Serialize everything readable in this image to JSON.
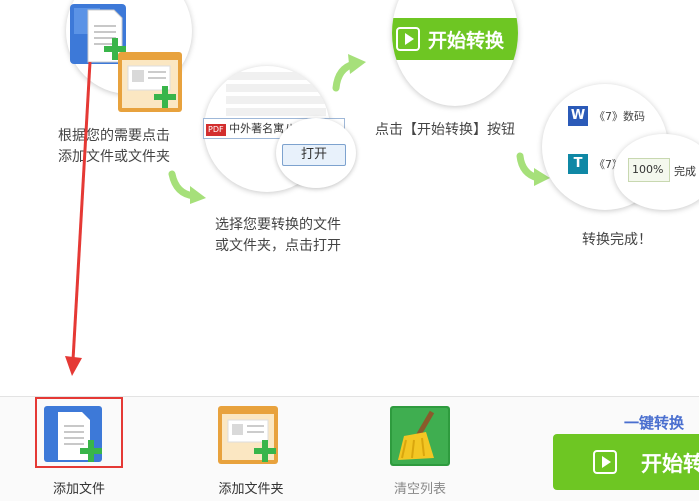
{
  "steps": {
    "step1_caption_line1": "根据您的需要点击",
    "step1_caption_line2": "添加文件或文件夹",
    "step2_caption_line1": "选择您要转换的文件",
    "step2_caption_line2": "或文件夹，点击打开",
    "step2_file_name": "中外著名寓八*.pdf,",
    "step2_open_button": "打开",
    "step3_start_label": "开始转换",
    "step3_caption": "点击【开始转换】按钮",
    "step4_row1_text": "《7》数码",
    "step4_row2_text": "《7》",
    "step4_progress": "100%",
    "step4_done_label": "完成",
    "step4_caption": "转换完成！"
  },
  "toolbar": {
    "add_file_label": "添加文件",
    "add_folder_label": "添加文件夹",
    "clear_list_label": "清空列表",
    "one_click_label": "一键转换",
    "start_button_label": "开始转"
  },
  "colors": {
    "accent_green": "#6ec623",
    "highlight_red": "#e53935",
    "link_blue": "#4a6fcf"
  }
}
